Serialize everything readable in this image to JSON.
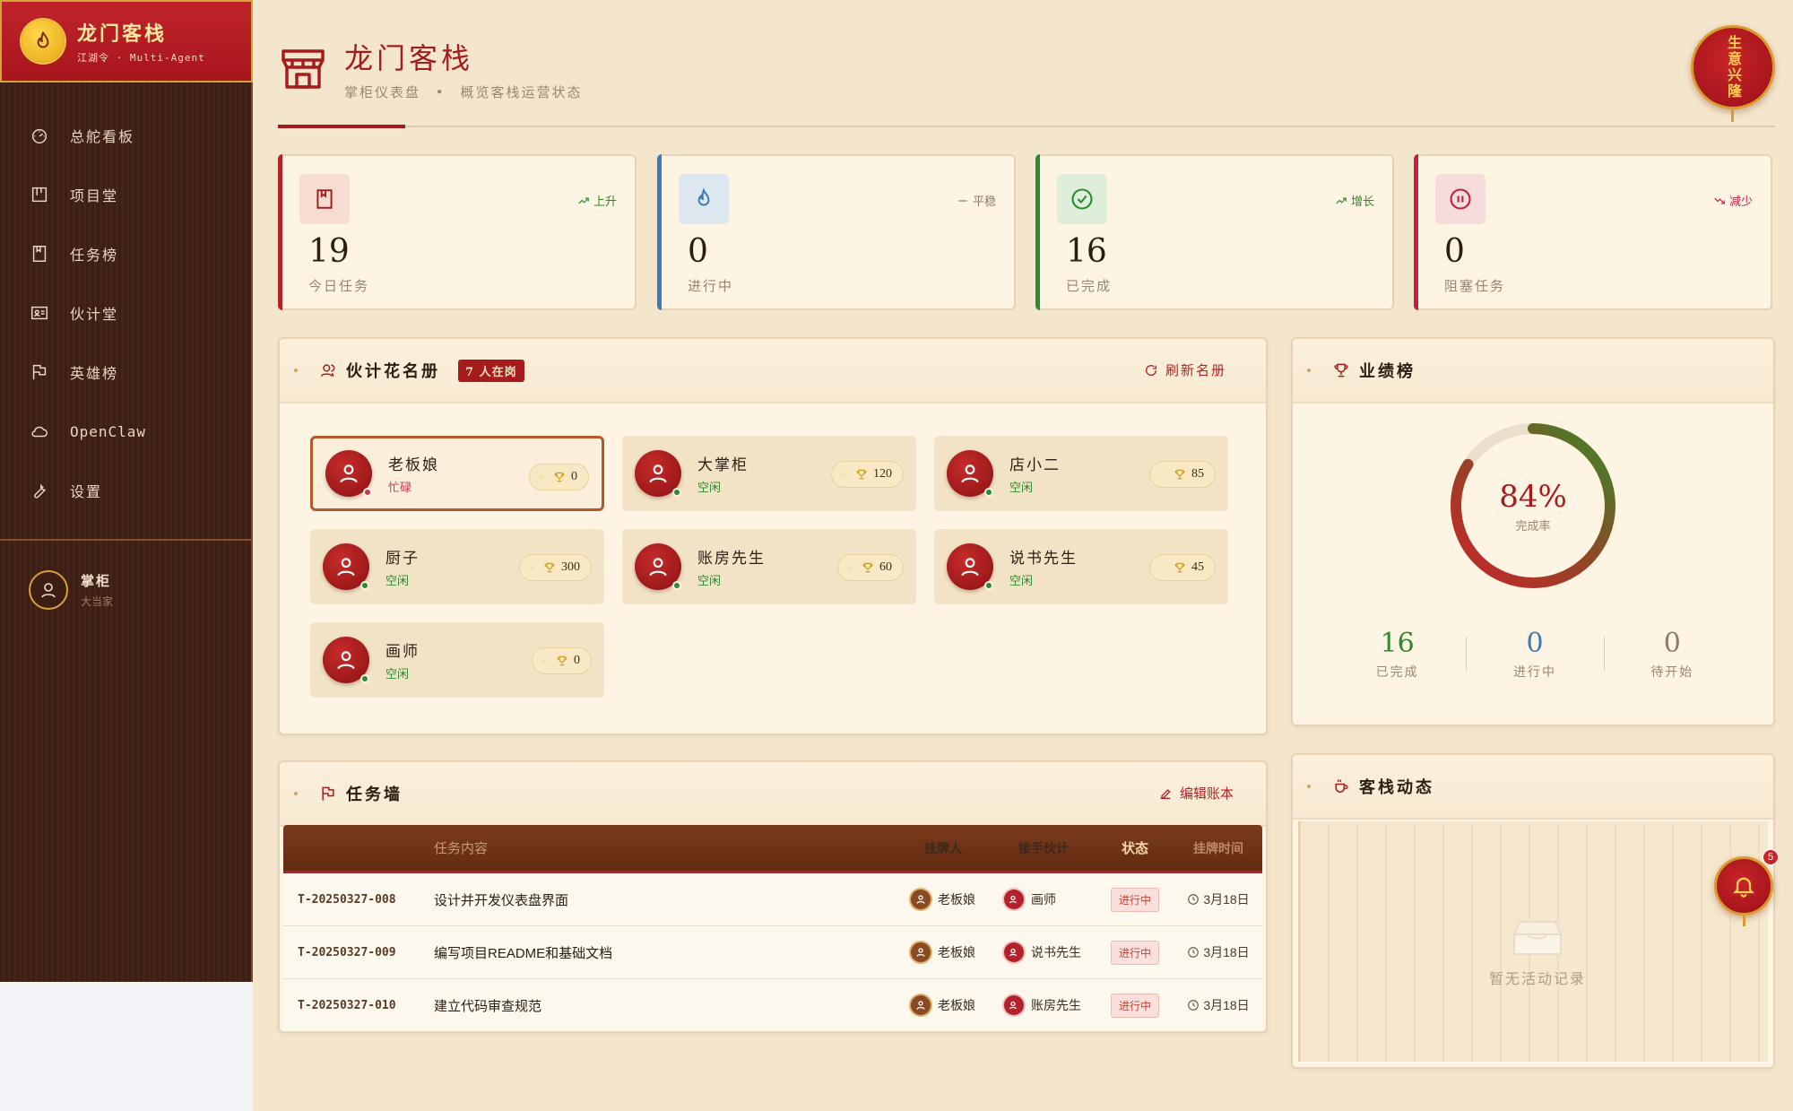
{
  "brand": {
    "title": "龙门客栈",
    "subtitle": "江湖令 · Multi-Agent"
  },
  "sidebar": {
    "items": [
      {
        "label": "总舵看板",
        "icon": "dashboard-icon"
      },
      {
        "label": "项目堂",
        "icon": "kanban-icon"
      },
      {
        "label": "任务榜",
        "icon": "bookmark-icon"
      },
      {
        "label": "伙计堂",
        "icon": "id-card-icon"
      },
      {
        "label": "英雄榜",
        "icon": "flag-icon"
      },
      {
        "label": "OpenClaw",
        "icon": "cloud-icon"
      },
      {
        "label": "设置",
        "icon": "wrench-icon"
      }
    ],
    "user": {
      "name": "掌柜",
      "role": "大当家"
    }
  },
  "header": {
    "title": "龙门客栈",
    "subtitle": "掌柜仪表盘",
    "separator": "•",
    "subtitle2": "概览客栈运营状态",
    "seal": "生意兴隆"
  },
  "stats": [
    {
      "value": "19",
      "label": "今日任务",
      "trend": "上升",
      "accent": "#b3222a"
    },
    {
      "value": "0",
      "label": "进行中",
      "trend": "平稳",
      "accent": "#3d7ab8"
    },
    {
      "value": "16",
      "label": "已完成",
      "trend": "增长",
      "accent": "#2e8a2e"
    },
    {
      "value": "0",
      "label": "阻塞任务",
      "trend": "减少",
      "accent": "#c22040"
    }
  ],
  "roster": {
    "title": "伙计花名册",
    "badge": "7 人在岗",
    "action": "刷新名册",
    "members": [
      {
        "name": "老板娘",
        "state": "忙碌",
        "score": "0",
        "state_color": "#d0344a"
      },
      {
        "name": "大掌柜",
        "state": "空闲",
        "score": "120",
        "state_color": "#2e8a2e"
      },
      {
        "name": "店小二",
        "state": "空闲",
        "score": "85",
        "state_color": "#2e8a2e"
      },
      {
        "name": "厨子",
        "state": "空闲",
        "score": "300",
        "state_color": "#2e8a2e"
      },
      {
        "name": "账房先生",
        "state": "空闲",
        "score": "60",
        "state_color": "#2e8a2e"
      },
      {
        "name": "说书先生",
        "state": "空闲",
        "score": "45",
        "state_color": "#2e8a2e"
      },
      {
        "name": "画师",
        "state": "空闲",
        "score": "0",
        "state_color": "#2e8a2e"
      }
    ]
  },
  "leaderboard": {
    "title": "业绩榜",
    "percent": "84%",
    "percent_value": 84,
    "percent_label": "完成率",
    "stats": [
      {
        "value": "16",
        "label": "已完成",
        "color": "#2e8a2e"
      },
      {
        "value": "0",
        "label": "进行中",
        "color": "#3d7ab8"
      },
      {
        "value": "0",
        "label": "待开始",
        "color": "#8c7a68"
      }
    ]
  },
  "tasks": {
    "title": "任务墙",
    "action": "编辑账本",
    "columns": {
      "content": "任务内容",
      "owner": "挂牌人",
      "assignee": "接手伙计",
      "status": "状态",
      "time": "挂牌时间"
    },
    "rows": [
      {
        "id": "T-20250327-008",
        "content": "设计并开发仪表盘界面",
        "owner": "老板娘",
        "assignee": "画师",
        "status": "进行中",
        "time": "3月18日"
      },
      {
        "id": "T-20250327-009",
        "content": "编写项目README和基础文档",
        "owner": "老板娘",
        "assignee": "说书先生",
        "status": "进行中",
        "time": "3月18日"
      },
      {
        "id": "T-20250327-010",
        "content": "建立代码审查规范",
        "owner": "老板娘",
        "assignee": "账房先生",
        "status": "进行中",
        "time": "3月18日"
      }
    ]
  },
  "activity": {
    "title": "客栈动态",
    "empty": "暂无活动记录"
  },
  "notifications": {
    "count": "5"
  }
}
